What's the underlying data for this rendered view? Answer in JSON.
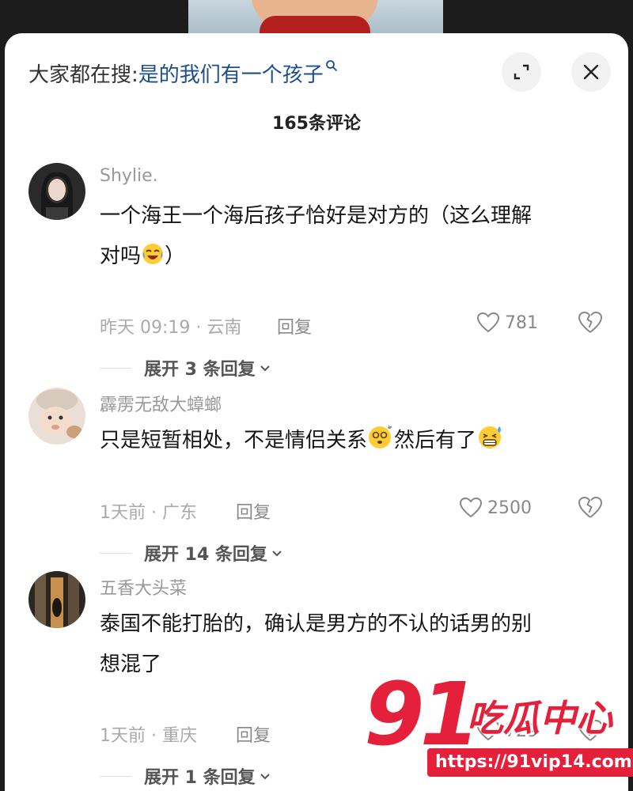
{
  "header": {
    "search_prefix": "大家都在搜:",
    "search_query": "是的我们有一个孩子"
  },
  "comment_count": "165条评论",
  "comments": [
    {
      "username": "Shylie.",
      "text_line1": "一个海王一个海后孩子恰好是对方的（这么理解",
      "text_line2_before": "对吗",
      "text_line2_emoji": "laughing-crying-emoji",
      "text_line2_after": "）",
      "time_location": "昨天 09:19 · 云南",
      "reply_label": "回复",
      "likes": "781",
      "expand_label": "展开 3 条回复"
    },
    {
      "username": "霹雳无敌大蟑螂",
      "text_before": "只是短暂相处，不是情侣关系",
      "emoji1": "dizzy-face-emoji",
      "text_middle": "然后有了",
      "emoji2": "sweat-grin-emoji",
      "time_location": "1天前 · 广东",
      "reply_label": "回复",
      "likes": "2500",
      "expand_label": "展开 14 条回复"
    },
    {
      "username": "五香大头菜",
      "text_line1": "泰国不能打胎的，确认是男方的不认的话男的别",
      "text_line2": "想混了",
      "time_location": "1天前 · 重庆",
      "reply_label": "回复",
      "likes": "729",
      "expand_label": "展开 1 条回复"
    }
  ],
  "watermark": {
    "number": "91",
    "brand": "吃瓜中心",
    "url": "https://91vip14.com"
  },
  "colors": {
    "accent_red": "#e5203a",
    "link_blue": "#1f4e8c"
  }
}
